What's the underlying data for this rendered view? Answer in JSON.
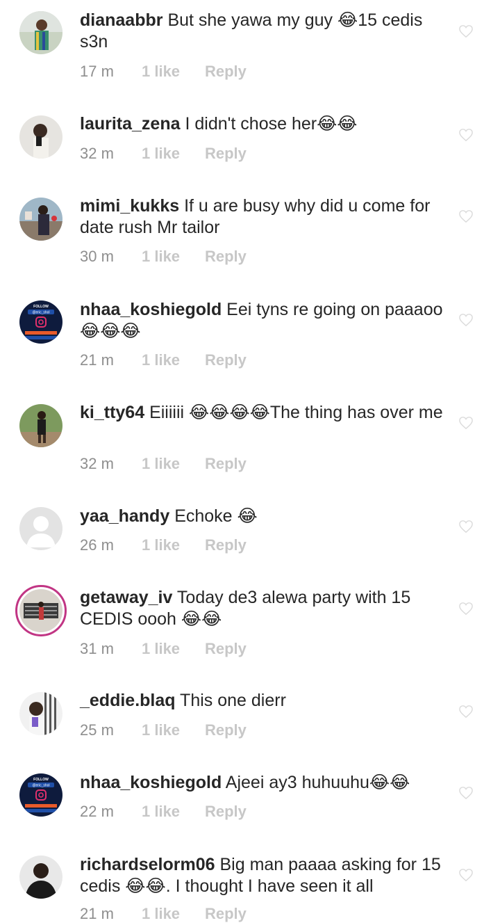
{
  "comments": [
    {
      "username": "dianaabbr",
      "text": "But she yawa my guy 😂15 cedis s3n",
      "time": "17 m",
      "likes": "1 like",
      "reply": "Reply"
    },
    {
      "username": "laurita_zena",
      "text": "I didn't chose her😂😂",
      "time": "32 m",
      "likes": "1 like",
      "reply": "Reply"
    },
    {
      "username": "mimi_kukks",
      "text": "If u are busy why did u come for date rush Mr tailor",
      "time": "30 m",
      "likes": "1 like",
      "reply": "Reply"
    },
    {
      "username": "nhaa_koshiegold",
      "text": "Eei tyns re going on paaaoo😂😂😂",
      "time": "21 m",
      "likes": "1 like",
      "reply": "Reply"
    },
    {
      "username": "ki_tty64",
      "text": "Eiiiiii 😂😂😂😂The thing has over me",
      "time": "32 m",
      "likes": "1 like",
      "reply": "Reply"
    },
    {
      "username": "yaa_handy",
      "text": "Echoke 😂",
      "time": "26 m",
      "likes": "1 like",
      "reply": "Reply"
    },
    {
      "username": "getaway_iv",
      "text": "Today de3 alewa  party with 15 CEDIS oooh 😂😂",
      "time": "31 m",
      "likes": "1 like",
      "reply": "Reply"
    },
    {
      "username": "_eddie.blaq",
      "text": "This one dierr",
      "time": "25 m",
      "likes": "1 like",
      "reply": "Reply"
    },
    {
      "username": "nhaa_koshiegold",
      "text": "Ajeei ay3 huhuuhu😂😂",
      "time": "22 m",
      "likes": "1 like",
      "reply": "Reply"
    },
    {
      "username": "richardselorm06",
      "text": "Big man paaaa asking for 15 cedis 😂😂. I thought I have seen it all",
      "time": "21 m",
      "likes": "1 like",
      "reply": "Reply"
    }
  ],
  "avatar_badge_text": {
    "follow": "FOLLOW",
    "handle": "@eric_shol"
  },
  "colors": {
    "username": "#262626",
    "meta": "#8e8e8e",
    "meta_light": "#c7c7c7",
    "story_ring": "#c13584"
  },
  "icons": {
    "like": "heart-outline-icon"
  }
}
